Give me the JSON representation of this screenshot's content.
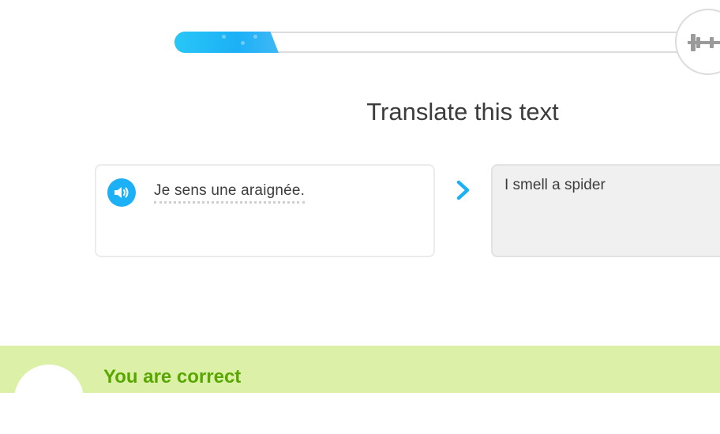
{
  "progress": {
    "fraction": 0.2
  },
  "title": "Translate this text",
  "source": {
    "text": "Je sens une araignée."
  },
  "answer": {
    "value": "I smell a spider"
  },
  "footer": {
    "message": "You are correct"
  },
  "colors": {
    "accent": "#1cb0f6",
    "success": "#58a700",
    "footer_bg": "#dcf0a8"
  },
  "icons": {
    "speaker": "speaker-icon",
    "arrow": "chevron-right-icon",
    "strength": "dumbbell-icon"
  }
}
